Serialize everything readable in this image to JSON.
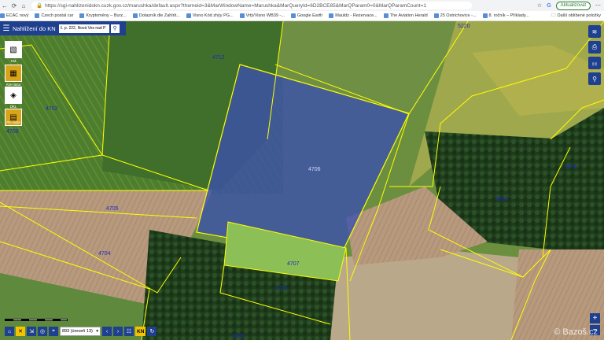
{
  "browser": {
    "url": "https://sgi-nahlizenidokn.cuzk.gov.cz/marushka/default.aspx?themeid=3&MarWindowName=Marushka&MarQueryId=6D2BCE85&MarQParam0=0&MarQParamCount=1",
    "update_button": "Aktualizovat"
  },
  "bookmarks": [
    {
      "label": "ECAC nový"
    },
    {
      "label": "Czech postal car"
    },
    {
      "label": "Kryptoměny – Burz..."
    },
    {
      "label": "Dotazník dle Zahlrit..."
    },
    {
      "label": "Visno Kód zhýy PG..."
    },
    {
      "label": "Vrtý/Visno WB39 -..."
    },
    {
      "label": "Google Earth"
    },
    {
      "label": "Mauldz - Rezervace..."
    },
    {
      "label": "The Aviation Herald"
    },
    {
      "label": "25 Ostrichovice -..."
    },
    {
      "label": "8. ročník – Příklady..."
    }
  ],
  "bookmarks_more": "Další oblíbené položky",
  "app": {
    "title": "Nahlížení do KN",
    "search_value": "č. p. 222, Nová Ves nad P"
  },
  "layers": [
    {
      "label": "KM"
    },
    {
      "label": "KM-rasta"
    },
    {
      "label": "DKL"
    },
    {
      "label": "PK-rasta"
    }
  ],
  "parcels": [
    {
      "label": "5220"
    },
    {
      "label": "4712"
    },
    {
      "label": "4702"
    },
    {
      "label": "4706"
    },
    {
      "label": "4705"
    },
    {
      "label": "4704"
    },
    {
      "label": "4707"
    },
    {
      "label": "4703"
    },
    {
      "label": "4694"
    },
    {
      "label": "4695"
    },
    {
      "label": "4696"
    },
    {
      "label": "4708"
    }
  ],
  "scale_select": "893 (úroveň 13)",
  "kn_label": "KN",
  "watermark": "© Bazoš.cz",
  "colors": {
    "header_blue": "#1f3f8f",
    "selected_parcel_fill": "#3b4fb0",
    "parcel_boundary": "#ffff00",
    "accent_yellow": "#f5c400"
  }
}
